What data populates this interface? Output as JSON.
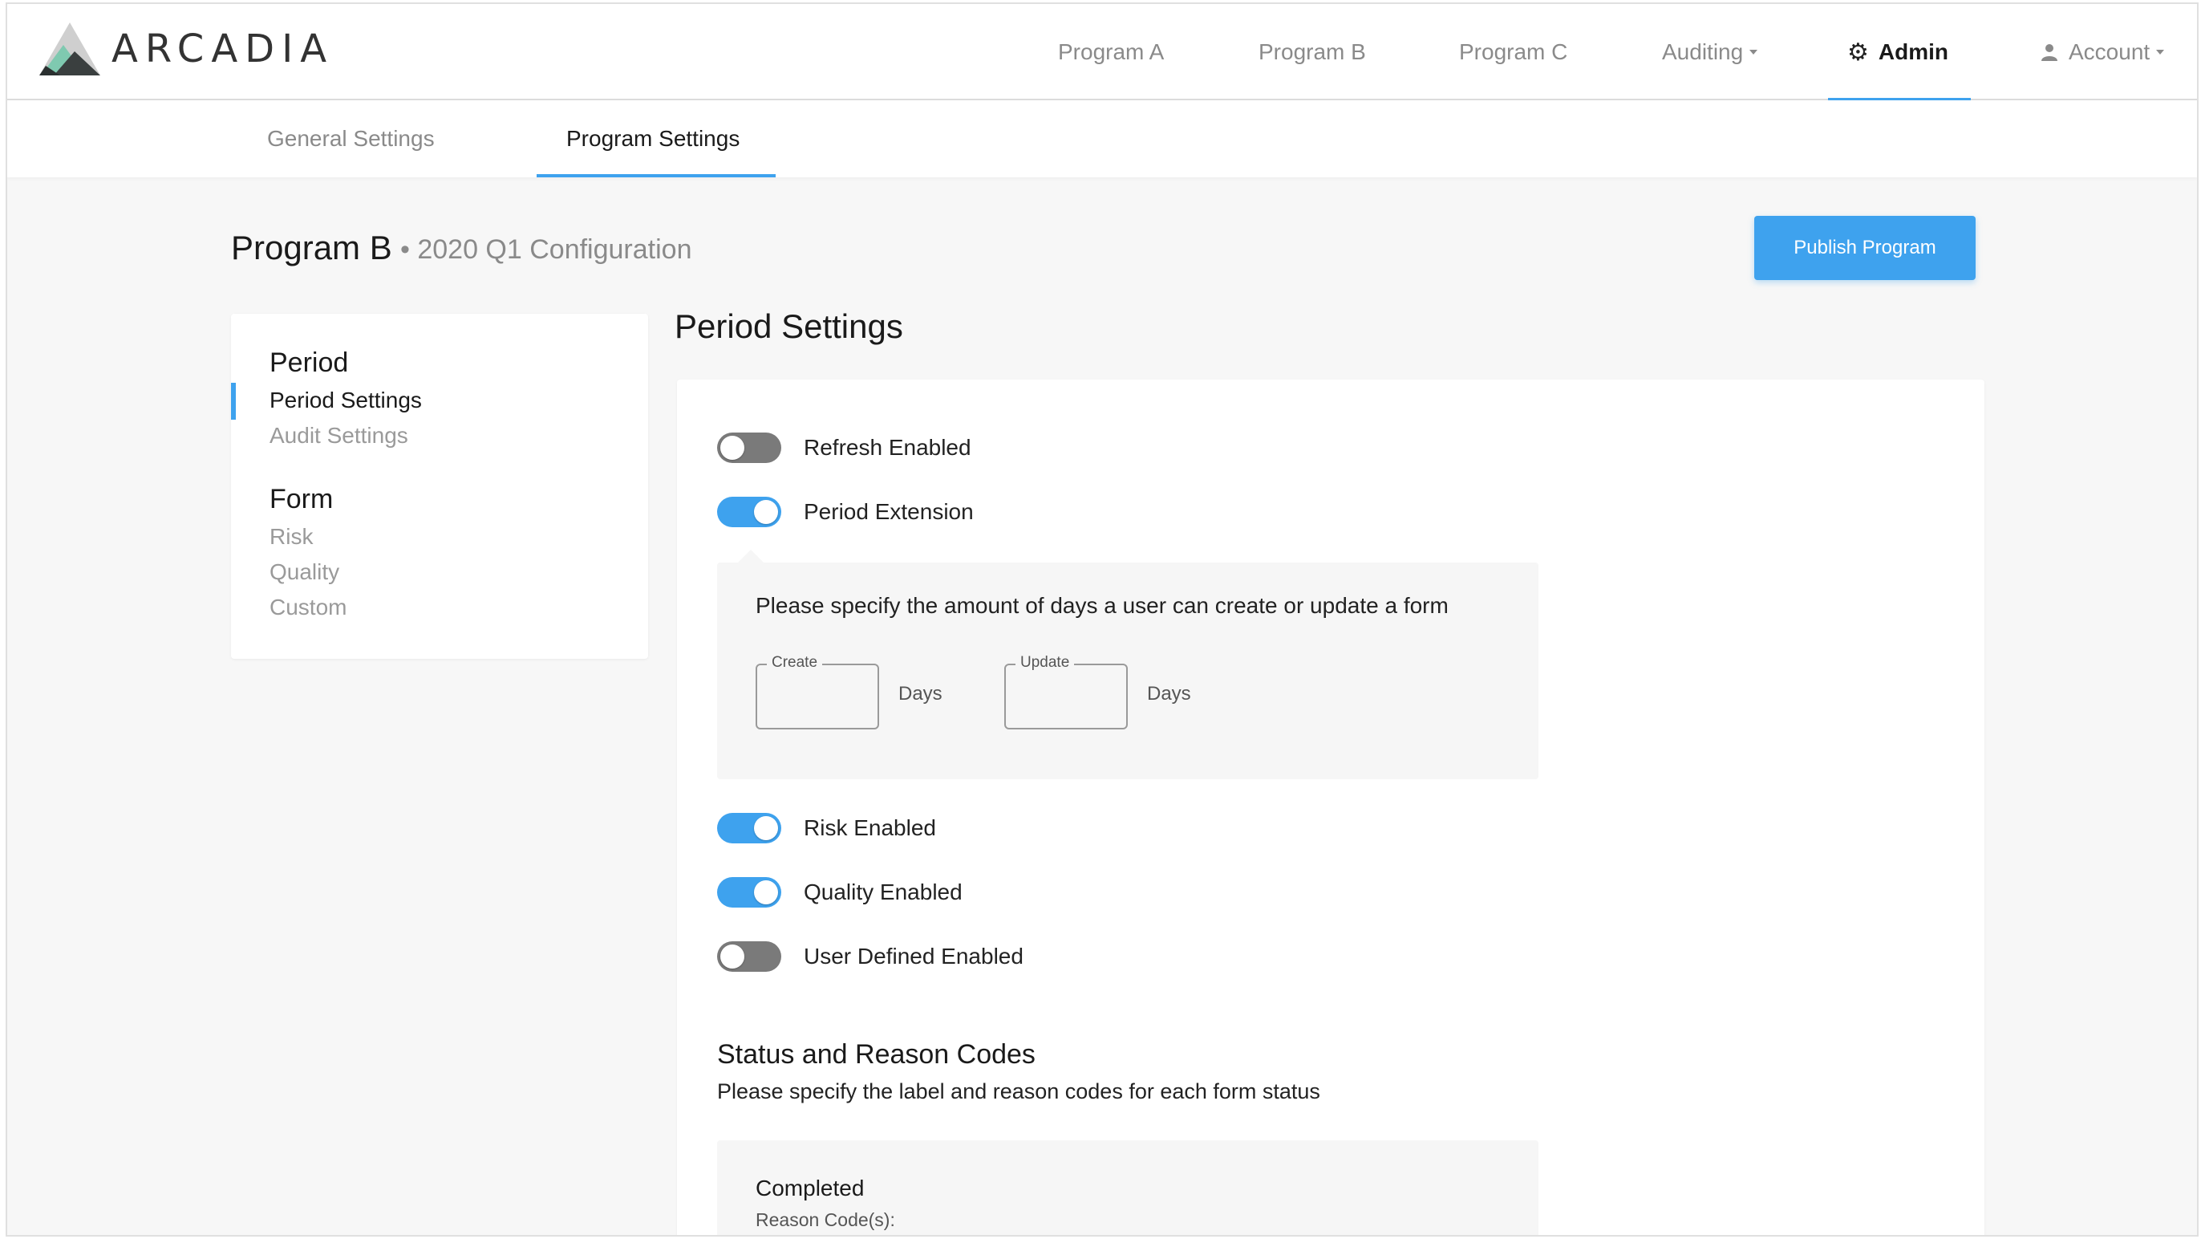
{
  "app": {
    "logo_text": "ARCADIA"
  },
  "nav": {
    "items": [
      {
        "label": "Program A"
      },
      {
        "label": "Program B"
      },
      {
        "label": "Program C"
      },
      {
        "label": "Auditing"
      },
      {
        "label": "Admin"
      },
      {
        "label": "Account"
      }
    ]
  },
  "subnav": {
    "tabs": [
      {
        "label": "General Settings"
      },
      {
        "label": "Program Settings"
      }
    ]
  },
  "header": {
    "title": "Program B",
    "subtitle": "• 2020 Q1 Configuration",
    "publish_label": "Publish Program"
  },
  "sidebar": {
    "groups": [
      {
        "heading": "Period",
        "items": [
          {
            "label": "Period Settings"
          },
          {
            "label": "Audit Settings"
          }
        ]
      },
      {
        "heading": "Form",
        "items": [
          {
            "label": "Risk"
          },
          {
            "label": "Quality"
          },
          {
            "label": "Custom"
          }
        ]
      }
    ]
  },
  "main": {
    "section_title": "Period Settings",
    "toggles": [
      {
        "label": "Refresh Enabled",
        "on": false
      },
      {
        "label": "Period Extension",
        "on": true
      },
      {
        "label": "Risk Enabled",
        "on": true
      },
      {
        "label": "Quality Enabled",
        "on": true
      },
      {
        "label": "User Defined Enabled",
        "on": false
      }
    ],
    "extension": {
      "text": "Please specify the amount of days a user can create or update a form",
      "create_legend": "Create",
      "create_value": "",
      "create_unit": "Days",
      "update_legend": "Update",
      "update_value": "",
      "update_unit": "Days"
    },
    "status": {
      "title": "Status and Reason Codes",
      "description": "Please specify the label and reason codes for each form status",
      "completed_title": "Completed",
      "reason_label": "Reason Code(s):"
    }
  },
  "colors": {
    "accent": "#3ea2ee",
    "toggle_off": "#7a7a7a"
  }
}
